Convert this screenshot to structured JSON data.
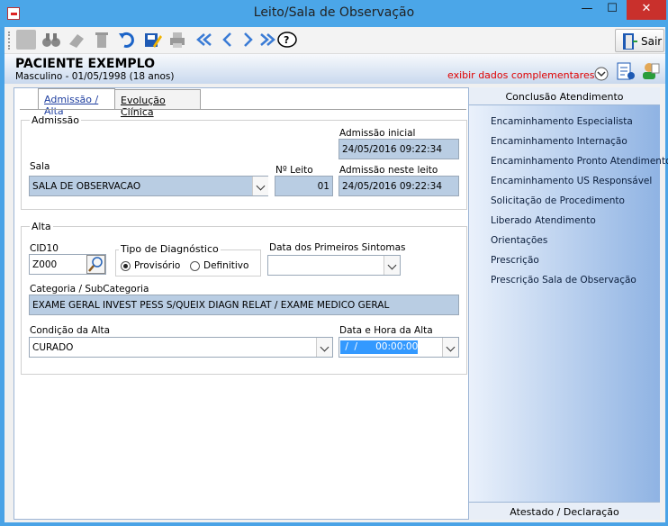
{
  "window": {
    "title": "Leito/Sala de Observação",
    "minimize": "—",
    "maximize": "☐",
    "close": "✕"
  },
  "toolbar": {
    "exit_label": "Sair"
  },
  "patient": {
    "name": "PACIENTE EXEMPLO",
    "info": "Masculino - 01/05/1998 (18 anos)",
    "more_link": "exibir dados complementares..."
  },
  "tabs": [
    {
      "label": "Admissão / Alta"
    },
    {
      "label": "Evolução Clínica"
    }
  ],
  "admissao": {
    "title": "Admissão",
    "initial_label": "Admissão inicial",
    "initial_value": "24/05/2016 09:22:34",
    "sala_label": "Sala",
    "sala_value": "SALA DE OBSERVACAO",
    "leito_label": "Nº Leito",
    "leito_value": "01",
    "bed_label": "Admissão neste leito",
    "bed_value": "24/05/2016 09:22:34"
  },
  "alta": {
    "title": "Alta",
    "cid_label": "CID10",
    "cid_value": "Z000",
    "diag_label": "Tipo de Diagnóstico",
    "diag_options": [
      "Provisório",
      "Definitivo"
    ],
    "sintomas_label": "Data dos Primeiros Sintomas",
    "sintomas_value": "",
    "categoria_label": "Categoria / SubCategoria",
    "categoria_value": "EXAME GERAL INVEST PESS S/QUEIX DIAGN RELAT / EXAME MEDICO GERAL",
    "condicao_label": "Condição da Alta",
    "condicao_value": "CURADO",
    "datahora_label": "Data e Hora da Alta",
    "datahora_value": " /  /      00:00:00"
  },
  "sidebar": {
    "header": "Conclusão Atendimento",
    "items": [
      "Encaminhamento Especialista",
      "Encaminhamento Internação",
      "Encaminhamento Pronto Atendimento",
      "Encaminhamento US Responsável",
      "Solicitação de Procedimento",
      "Liberado Atendimento",
      "Orientações",
      "Prescrição",
      "Prescrição Sala de Observação"
    ],
    "footer": "Atestado / Declaração"
  },
  "colors": {
    "titlebar": "#4ba6e8",
    "field_bg": "#b9cde3",
    "link_red": "#e00000",
    "close_red": "#c9302c"
  }
}
